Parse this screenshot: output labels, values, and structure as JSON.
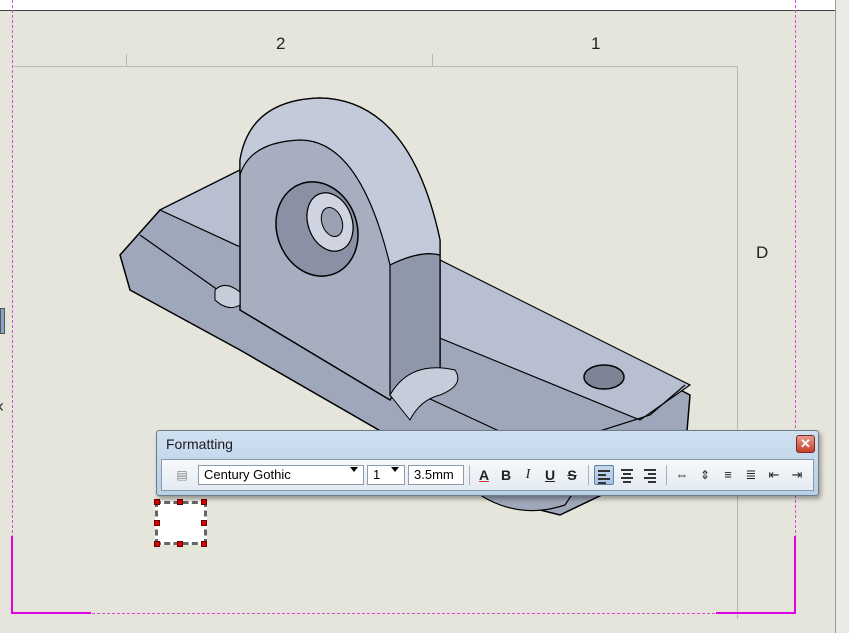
{
  "drawing": {
    "zone_labels": [
      "2",
      "1"
    ],
    "row_label": "D"
  },
  "formatting_toolbar": {
    "title": "Formatting",
    "close_icon": "close-icon",
    "font_name": "Century Gothic",
    "font_size": "1",
    "text_height": "3.5mm",
    "buttons": [
      {
        "name": "font-color-button",
        "glyph": "A"
      },
      {
        "name": "bold-button",
        "glyph": "B"
      },
      {
        "name": "italic-button",
        "glyph": "I"
      },
      {
        "name": "underline-button",
        "glyph": "U"
      },
      {
        "name": "strikethrough-button",
        "glyph": "S"
      }
    ]
  },
  "colors": {
    "sheet_background": "#e6e5dc",
    "margin_line": "#e000e0",
    "part_fill": "#a9b0c2",
    "selection_handle": "#dd0000"
  }
}
